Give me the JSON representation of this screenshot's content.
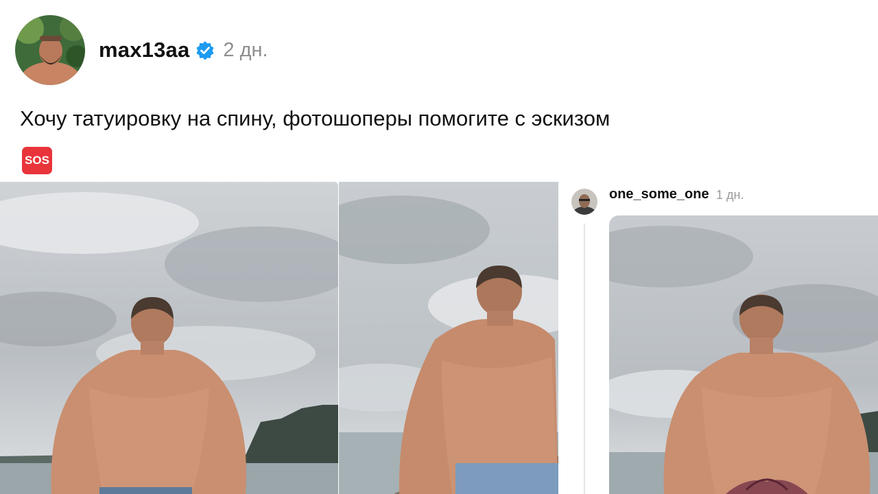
{
  "post": {
    "username": "max13aa",
    "time": "2 дн.",
    "caption": "Хочу татуировку на спину, фотошоперы помогите с эскизом",
    "caption_emoji": "SOS",
    "images": [
      "back-photo-1",
      "back-photo-2"
    ]
  },
  "reply": {
    "username": "one_some_one",
    "time": "1 дн.",
    "images": [
      "back-photo-edited-with-tattoo"
    ]
  },
  "icons": {
    "verified": "verified-badge-icon",
    "sos": "sos-emoji-icon"
  },
  "colors": {
    "verified_blue": "#1d9bf0",
    "sos_red": "#e8343a",
    "timestamp_grey": "#8e8e8e"
  }
}
